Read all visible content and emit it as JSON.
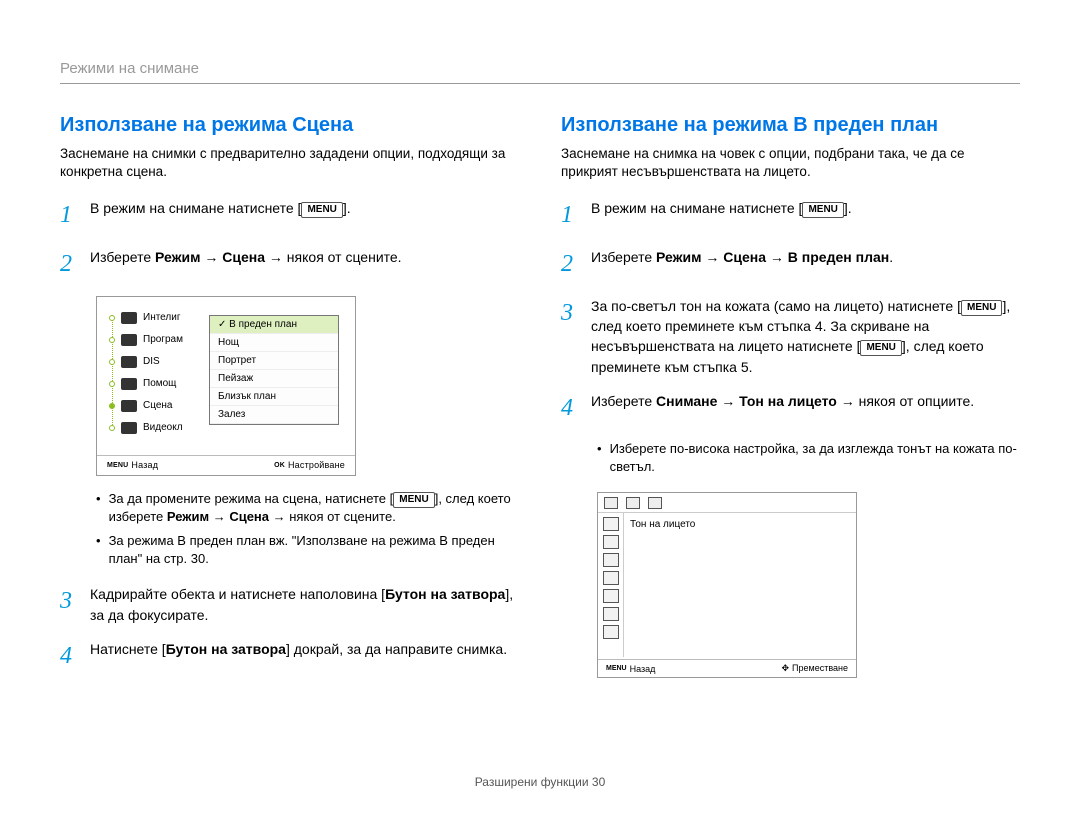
{
  "breadcrumb": "Режими на снимане",
  "left": {
    "title": "Използване на режима Сцена",
    "intro": "Заснемане на снимки с предварително зададени опции, подходящи за конкретна сцена.",
    "step1_pre": "В режим на снимане натиснете [",
    "step1_post": "].",
    "menu_label": "MENU",
    "step2_pre": "Изберете ",
    "step2_b": "Режим → Сцена",
    "step2_post": " → някоя от сцените.",
    "shot": {
      "left_items": [
        "Интелиг",
        "Програм",
        "DIS",
        "Помощ",
        "Сцена",
        "Видеокл"
      ],
      "right_items": [
        "В преден план",
        "Нощ",
        "Портрет",
        "Пейзаж",
        "Близък план",
        "Залез"
      ],
      "back_menu": "MENU",
      "back": "Назад",
      "ok": "OK",
      "adjust": "Настройване"
    },
    "bullet1_pre": "За да промените режима на сцена, натиснете [",
    "bullet1_mid": "], след което изберете ",
    "bullet1_b": "Режим → Сцена",
    "bullet1_post": " → някоя от сцените.",
    "bullet2": "За режима В преден план вж. \"Използване на режима В преден план\" на стр. 30.",
    "step3_pre": "Кадрирайте обекта и натиснете наполовина [",
    "step3_b": "Бутон на затвора",
    "step3_post": "], за да фокусирате.",
    "step4_pre": "Натиснете [",
    "step4_b": "Бутон на затвора",
    "step4_post": "] докрай, за да направите снимка."
  },
  "right": {
    "title": "Използване на режима В преден план",
    "intro": "Заснемане на снимка на човек с опции, подбрани така, че да се прикрият несъвършенствата на лицето.",
    "step1_pre": "В режим на снимане натиснете [",
    "step1_post": "].",
    "menu_label": "MENU",
    "step2_pre": "Изберете ",
    "step2_b": "Режим → Сцена → В преден план",
    "step2_post": ".",
    "step3_a": "За по-светъл тон на кожата (само на лицето) натиснете [",
    "step3_b": "], след което преминете към стъпка 4. За скриване на несъвършенствата на лицето натиснете [",
    "step3_c": "], след което преминете към стъпка 5.",
    "step4_pre": "Изберете ",
    "step4_b": "Снимане → Тон на лицето",
    "step4_post": " → някоя от опциите.",
    "bullet": "Изберете по-висока настройка, за да изглежда тонът на кожата по-светъл.",
    "shot": {
      "label": "Тон на лицето",
      "back_menu": "MENU",
      "back": "Назад",
      "move": "Преместване"
    }
  },
  "footer_label": "Разширени функции  ",
  "footer_page": "30"
}
